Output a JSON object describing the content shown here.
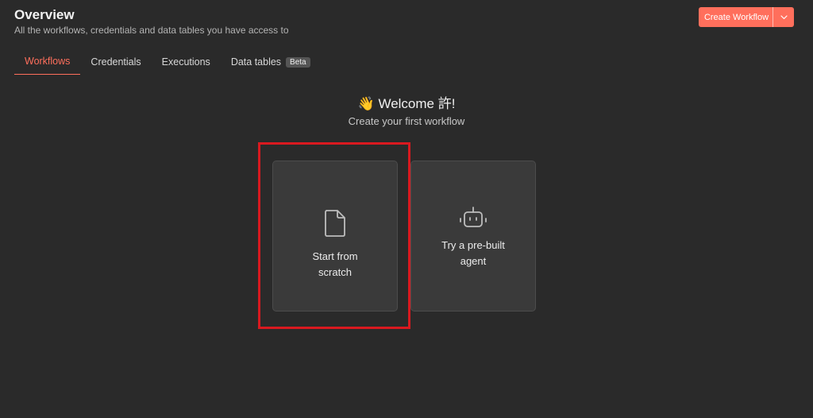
{
  "header": {
    "title": "Overview",
    "subtitle": "All the workflows, credentials and data tables you have access to"
  },
  "create_button": {
    "label": "Create Workflow",
    "caret_icon": "chevron-down-icon"
  },
  "tabs": [
    {
      "label": "Workflows",
      "active": true
    },
    {
      "label": "Credentials",
      "active": false
    },
    {
      "label": "Executions",
      "active": false
    },
    {
      "label": "Data tables",
      "active": false,
      "badge": "Beta"
    }
  ],
  "welcome": {
    "emoji": "👋",
    "title": "Welcome 許!",
    "subtitle": "Create your first workflow"
  },
  "cards": [
    {
      "label": "Start from scratch",
      "icon": "file-icon"
    },
    {
      "label": "Try a pre-built agent",
      "icon": "robot-icon"
    }
  ],
  "colors": {
    "background": "#2a2a2a",
    "accent": "#ff6f5c",
    "card": "#3a3a3a",
    "highlight": "#d9191f"
  }
}
